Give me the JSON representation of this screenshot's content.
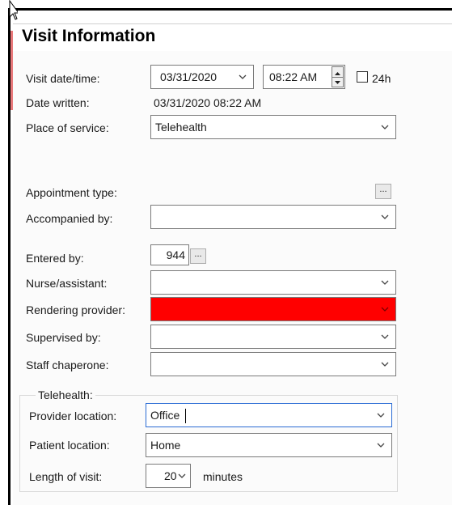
{
  "title": "Visit Information",
  "visit": {
    "datetime_label": "Visit date/time:",
    "date_value": "03/31/2020",
    "time_value": "08:22 AM",
    "checkbox_24h_label": "24h",
    "checkbox_24h_checked": false,
    "date_written_label": "Date written:",
    "date_written_value": "03/31/2020 08:22 AM",
    "place_label": "Place of service:",
    "place_value": "Telehealth",
    "appointment_label": "Appointment type:",
    "accompanied_label": "Accompanied by:",
    "accompanied_value": "",
    "entered_label": "Entered by:",
    "entered_value": "944",
    "nurse_label": "Nurse/assistant:",
    "nurse_value": "",
    "rendering_label": "Rendering provider:",
    "rendering_value": "",
    "supervised_label": "Supervised by:",
    "supervised_value": "",
    "chaperone_label": "Staff chaperone:",
    "chaperone_value": ""
  },
  "telehealth": {
    "group_label": "Telehealth:",
    "provider_location_label": "Provider location:",
    "provider_location_value": "Office",
    "patient_location_label": "Patient location:",
    "patient_location_value": "Home",
    "length_label": "Length of visit:",
    "length_value": "20",
    "length_unit": "minutes"
  },
  "ellipsis_label": "...",
  "colors": {
    "required_highlight": "#ff0000",
    "focus_border": "#2b6cd4",
    "accent_strip": "#e8787a"
  },
  "icons": {
    "dropdown": "chevron-down-icon",
    "cursor": "mouse-pointer-icon"
  }
}
